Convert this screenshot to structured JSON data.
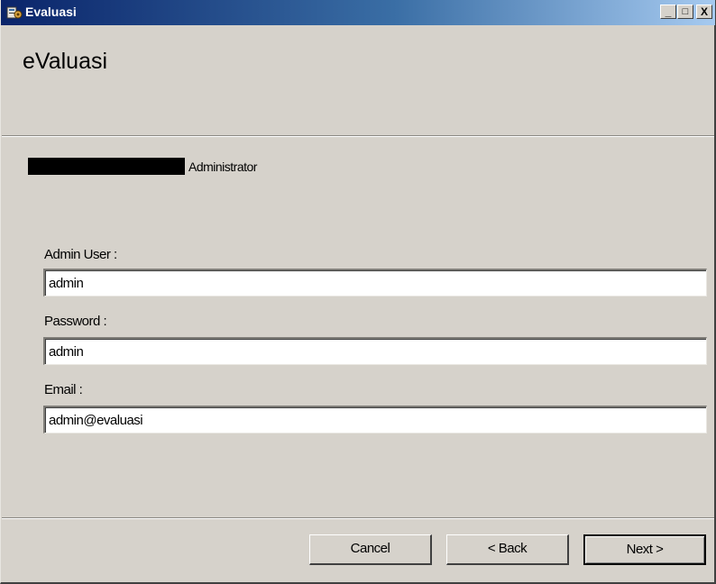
{
  "window": {
    "title": "Evaluasi",
    "controls": {
      "minimize": "_",
      "maximize": "□",
      "close": "X"
    }
  },
  "header": {
    "app_name": "eValuasi"
  },
  "step": {
    "subtitle": "Administrator"
  },
  "form": {
    "admin_user": {
      "label": "Admin User :",
      "value": "admin"
    },
    "password": {
      "label": "Password :",
      "value": "admin"
    },
    "email": {
      "label": "Email :",
      "value": "admin@evaluasi"
    }
  },
  "buttons": {
    "cancel": "Cancel",
    "back": "< Back",
    "next": "Next >"
  },
  "colors": {
    "window_bg": "#d6d2cb",
    "titlebar_start": "#0a246a",
    "titlebar_end": "#a6caf0"
  }
}
